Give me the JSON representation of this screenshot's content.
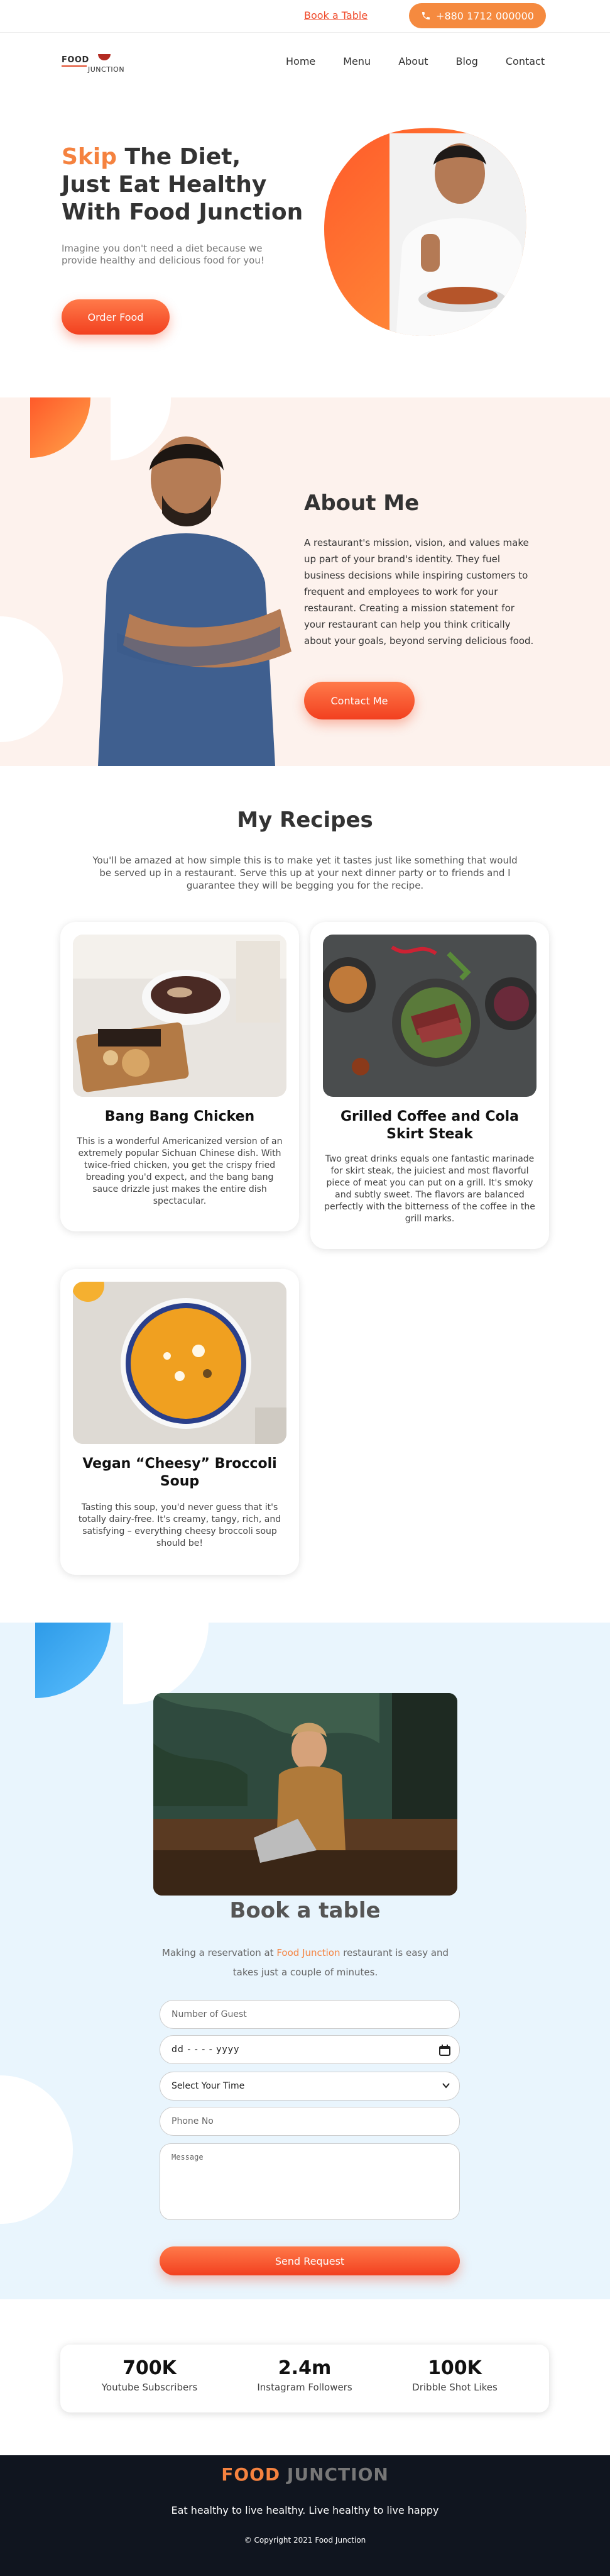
{
  "topbar": {
    "book_label": "Book a Table",
    "phone": "+880 1712 000000"
  },
  "logo": {
    "line1": "FOOD",
    "line2": "JUNCTION"
  },
  "nav": {
    "items": [
      "Home",
      "Menu",
      "About",
      "Blog",
      "Contact"
    ]
  },
  "hero": {
    "accent": "Skip",
    "title_rest": " The Diet,",
    "title_line2": "Just Eat Healthy",
    "title_line3": "With Food Junction",
    "subtitle": "Imagine you don't need a diet because we provide healthy and delicious food for you!",
    "button": "Order Food"
  },
  "about": {
    "title": "About Me",
    "text": "A restaurant's mission, vision, and values make up part of your brand's identity. They fuel business decisions while inspiring customers to frequent and employees to work for your restaurant. Creating a mission statement for your restaurant can help you think critically about your goals, beyond serving delicious food.",
    "button": "Contact Me"
  },
  "recipes": {
    "title": "My Recipes",
    "intro": "You'll be amazed at how simple this is to make yet it tastes just like something that would be served up in a restaurant. Serve this up at your next dinner party or to friends and I guarantee they will be begging you for the recipe.",
    "cards": [
      {
        "title": "Bang Bang Chicken",
        "text": "This is a wonderful Americanized version of an extremely popular Sichuan Chinese dish. With twice-fried chicken, you get the crispy fried breading you'd expect, and the bang bang sauce drizzle just makes the entire dish spectacular."
      },
      {
        "title": "Grilled Coffee and Cola Skirt Steak",
        "text": "Two great drinks equals one fantastic marinade for skirt steak, the juiciest and most flavorful piece of meat you can put on a grill. It's smoky and subtly sweet. The flavors are balanced perfectly with the bitterness of the coffee in the grill marks."
      },
      {
        "title": "Vegan “Cheesy” Broccoli Soup",
        "text": "Tasting this soup, you'd never guess that it's totally dairy-free. It's creamy, tangy, rich, and satisfying – everything cheesy broccoli soup should be!"
      }
    ]
  },
  "booking": {
    "title": "Book a table",
    "text_before": "Making a reservation at ",
    "text_highlight": "Food Junction",
    "text_after": " restaurant is easy and takes just a couple of minutes.",
    "guest_placeholder": "Number of Guest",
    "date_value": "dd - - - - yyyy",
    "time_value": "Select Your Time",
    "phone_placeholder": "Phone No",
    "message_placeholder": "Message",
    "button": "Send Request"
  },
  "stats": [
    {
      "value": "700K",
      "label": "Youtube Subscribers"
    },
    {
      "value": "2.4m",
      "label": "Instagram Followers"
    },
    {
      "value": "100K",
      "label": "Dribble Shot Likes"
    }
  ],
  "footer": {
    "brand_a": "FOOD",
    "brand_b": " JUNCTION",
    "tagline": "Eat healthy to live healthy. Live healthy to live happy",
    "copyright": "© Copyright 2021 Food Junction"
  },
  "colors": {
    "accent": "#f5823f",
    "button": "#f2401f",
    "about_bg": "#fdf2ed",
    "booking_bg": "#e9f5fd",
    "footer_bg": "#10151f"
  }
}
